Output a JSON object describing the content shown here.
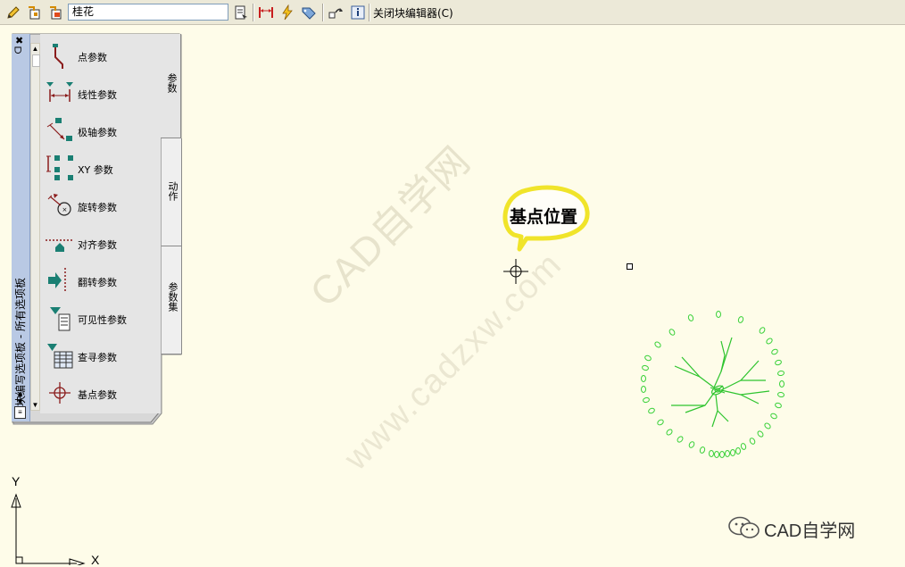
{
  "toolbar": {
    "block_name": "桂花",
    "close_editor_label": "关闭块编辑器(C)"
  },
  "palette": {
    "title": "块编写选项板 - 所有选项板",
    "items": [
      {
        "label": "点参数",
        "icon": "point-parameter-icon"
      },
      {
        "label": "线性参数",
        "icon": "linear-parameter-icon"
      },
      {
        "label": "极轴参数",
        "icon": "polar-parameter-icon"
      },
      {
        "label": "XY 参数",
        "icon": "xy-parameter-icon"
      },
      {
        "label": "旋转参数",
        "icon": "rotation-parameter-icon"
      },
      {
        "label": "对齐参数",
        "icon": "alignment-parameter-icon"
      },
      {
        "label": "翻转参数",
        "icon": "flip-parameter-icon"
      },
      {
        "label": "可见性参数",
        "icon": "visibility-parameter-icon"
      },
      {
        "label": "查寻参数",
        "icon": "lookup-parameter-icon"
      },
      {
        "label": "基点参数",
        "icon": "basepoint-parameter-icon"
      }
    ],
    "tabs": [
      {
        "label": "参数",
        "active": true
      },
      {
        "label": "动作",
        "active": false
      },
      {
        "label": "参数集",
        "active": false
      }
    ]
  },
  "canvas": {
    "bubble_text": "基点位置",
    "watermark_1": "CAD自学网",
    "watermark_2": "www.cadzxw.com",
    "brand_text": "CAD自学网",
    "ucs_x": "X",
    "ucs_y": "Y"
  },
  "colors": {
    "canvas_bg": "#fefce9",
    "drawing_green": "#2ecc2e",
    "bubble_yellow": "#f0e42a",
    "param_teal": "#1a7f73",
    "param_red": "#a01c1c"
  }
}
